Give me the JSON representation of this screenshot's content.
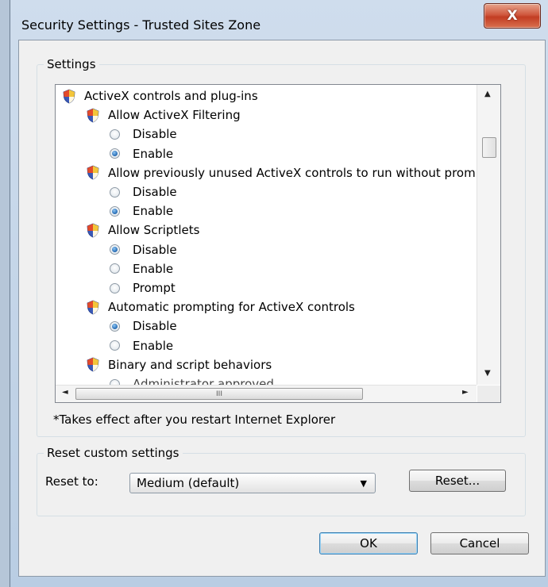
{
  "window": {
    "title": "Security Settings - Trusted Sites Zone",
    "close_glyph": "X"
  },
  "settings_group": {
    "label": "Settings",
    "items": [
      {
        "type": "category",
        "label": "ActiveX controls and plug-ins"
      },
      {
        "type": "setting",
        "label": "Allow ActiveX Filtering"
      },
      {
        "type": "radio",
        "label": "Disable",
        "checked": false
      },
      {
        "type": "radio",
        "label": "Enable",
        "checked": true
      },
      {
        "type": "setting",
        "label": "Allow previously unused ActiveX controls to run without prom"
      },
      {
        "type": "radio",
        "label": "Disable",
        "checked": false
      },
      {
        "type": "radio",
        "label": "Enable",
        "checked": true
      },
      {
        "type": "setting",
        "label": "Allow Scriptlets"
      },
      {
        "type": "radio",
        "label": "Disable",
        "checked": true
      },
      {
        "type": "radio",
        "label": "Enable",
        "checked": false
      },
      {
        "type": "radio",
        "label": "Prompt",
        "checked": false
      },
      {
        "type": "setting",
        "label": "Automatic prompting for ActiveX controls"
      },
      {
        "type": "radio",
        "label": "Disable",
        "checked": true
      },
      {
        "type": "radio",
        "label": "Enable",
        "checked": false
      },
      {
        "type": "setting",
        "label": "Binary and script behaviors"
      },
      {
        "type": "radio",
        "label": "Administrator approved",
        "checked": false
      }
    ],
    "hscroll_thumb_glyph": "III",
    "note": "*Takes effect after you restart Internet Explorer"
  },
  "reset_group": {
    "label": "Reset custom settings",
    "reset_to_label": "Reset to:",
    "selected_level": "Medium (default)",
    "reset_button": "Reset..."
  },
  "footer": {
    "ok": "OK",
    "cancel": "Cancel"
  }
}
